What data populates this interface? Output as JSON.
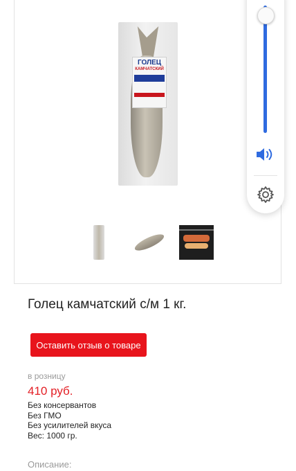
{
  "product": {
    "title": "Голец камчатский с/м 1 кг.",
    "package_label": {
      "brand": "ГОЛЕЦ",
      "subtitle": "КАМЧАТСКИЙ"
    },
    "review_button_label": "Оставить отзыв о товаре",
    "retail_label": "в розницу",
    "price": "410 руб.",
    "features": [
      "Без консервантов",
      "Без ГМО",
      "Без усилителей вкуса",
      "Вес: 1000 гр."
    ],
    "description_label": "Описание:"
  },
  "gallery": {
    "thumbnails": [
      "packaged-fish-thumbnail",
      "whole-fish-thumbnail",
      "grilled-fish-thumbnail"
    ]
  },
  "volume_panel": {
    "level": 1.0,
    "icons": [
      "speaker-icon",
      "gear-icon"
    ]
  },
  "colors": {
    "accent_red": "#e8141c",
    "price_red": "#e31e24",
    "slider_blue": "#2f6be0"
  }
}
